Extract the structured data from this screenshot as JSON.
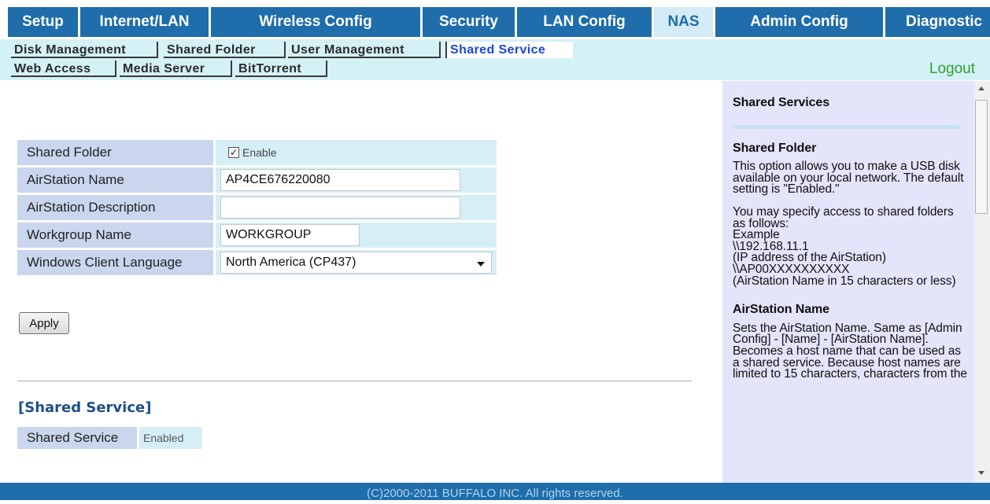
{
  "topnav": {
    "tabs": [
      {
        "label": "Setup",
        "active": false
      },
      {
        "label": "Internet/LAN",
        "active": false
      },
      {
        "label": "Wireless Config",
        "active": false
      },
      {
        "label": "Security",
        "active": false
      },
      {
        "label": "LAN Config",
        "active": false
      },
      {
        "label": "NAS",
        "active": true
      },
      {
        "label": "Admin Config",
        "active": false
      },
      {
        "label": "Diagnostic",
        "active": false
      }
    ]
  },
  "subnav": {
    "items": [
      {
        "label": "Disk Management",
        "active": false
      },
      {
        "label": "Shared Folder",
        "active": false
      },
      {
        "label": "User Management",
        "active": false
      },
      {
        "label": "Shared Service",
        "active": true
      },
      {
        "label": "Web Access",
        "active": false
      },
      {
        "label": "Media Server",
        "active": false
      },
      {
        "label": "BitTorrent",
        "active": false
      }
    ],
    "logout_label": "Logout"
  },
  "form": {
    "shared_folder": {
      "label": "Shared Folder",
      "checkbox_label": "Enable",
      "checked": true
    },
    "airstation_name": {
      "label": "AirStation Name",
      "value": "AP4CE676220080"
    },
    "airstation_description": {
      "label": "AirStation Description",
      "value": ""
    },
    "workgroup_name": {
      "label": "Workgroup Name",
      "value": "WORKGROUP"
    },
    "windows_client_language": {
      "label": "Windows Client Language",
      "value": "North America (CP437)"
    },
    "apply_label": "Apply"
  },
  "status": {
    "heading": "[Shared Service]",
    "label": "Shared Service",
    "value": "Enabled"
  },
  "help": {
    "title": "Shared Services",
    "sections": [
      {
        "heading": "Shared Folder",
        "paragraphs": [
          "This option allows you to make a USB disk available on your local network. The default setting is \"Enabled.\"",
          "You may specify access to shared folders as follows:\nExample\n\\\\192.168.11.1\n(IP address of the AirStation)\n\\\\AP00XXXXXXXXXX\n(AirStation Name in 15 characters or less)"
        ]
      },
      {
        "heading": "AirStation Name",
        "paragraphs": [
          "Sets the AirStation Name. Same as [Admin Config] - [Name] - [AirStation Name]. Becomes a host name that can be used as a shared service. Because host names are limited to 15 characters, characters from the"
        ]
      }
    ]
  },
  "footer": {
    "text": "(C)2000-2011 BUFFALO INC. All rights reserved."
  }
}
